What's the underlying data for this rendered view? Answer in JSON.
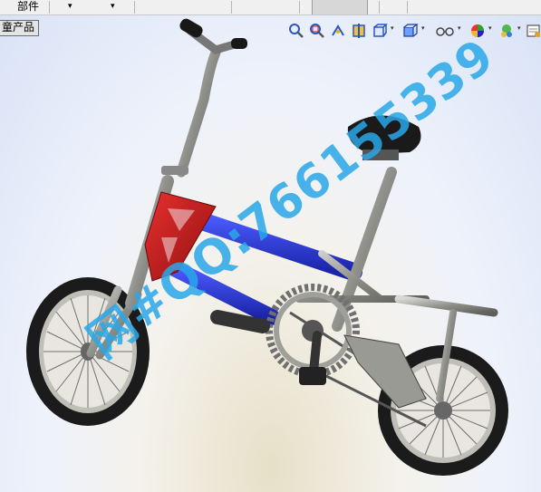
{
  "toolbar": {
    "part_label": "部件",
    "dropdown_arrow_1": "▾",
    "dropdown_arrow_2": "▾",
    "dropdown_arrow_3": "▾"
  },
  "viewport": {
    "tab_label": "童产品",
    "watermark": "网#QQ:766155339"
  },
  "view_icons": [
    {
      "name": "zoom-to-fit-icon"
    },
    {
      "name": "zoom-to-area-icon"
    },
    {
      "name": "previous-view-icon"
    },
    {
      "name": "section-view-icon"
    },
    {
      "name": "view-orientation-icon"
    },
    {
      "name": "display-style-icon"
    },
    {
      "name": "hide-show-items-icon"
    },
    {
      "name": "edit-appearance-icon"
    },
    {
      "name": "apply-scene-icon"
    },
    {
      "name": "view-settings-icon"
    }
  ],
  "colors": {
    "frame_blue": "#2e3ed8",
    "frame_red": "#c81818",
    "metal": "#9a9a94",
    "tire": "#1a1a1a",
    "watermark": "#2aa8e8"
  }
}
